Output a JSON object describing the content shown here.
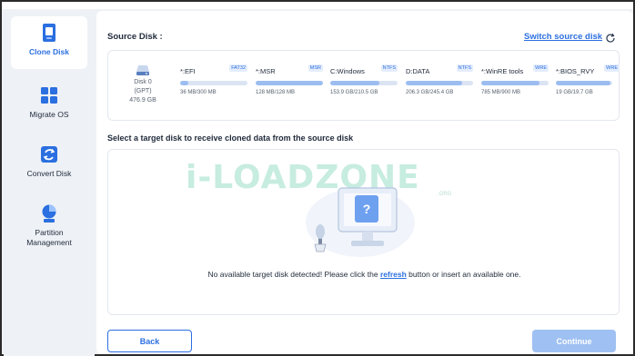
{
  "sidebar": {
    "items": [
      {
        "label": "Clone Disk",
        "icon": "clone-disk-icon",
        "active": true
      },
      {
        "label": "Migrate OS",
        "icon": "migrate-os-icon",
        "active": false
      },
      {
        "label": "Convert Disk",
        "icon": "convert-disk-icon",
        "active": false
      },
      {
        "label": "Partition\nManagement",
        "icon": "partition-management-icon",
        "active": false
      }
    ]
  },
  "source": {
    "title": "Source Disk :",
    "switch_label": "Switch source disk",
    "disk": {
      "name": "Disk 0",
      "style": "(GPT)",
      "size": "476.9 GB"
    },
    "partitions": [
      {
        "name": "*:EFI",
        "fs": "FAT32",
        "size": "36 MB/300 MB",
        "used_fraction": 0.12
      },
      {
        "name": "*:MSR",
        "fs": "MSR",
        "size": "128 MB/128 MB",
        "used_fraction": 1.0
      },
      {
        "name": "C:Windows",
        "fs": "NTFS",
        "size": "153.9 GB/210.5 GB",
        "used_fraction": 0.73
      },
      {
        "name": "D:DATA",
        "fs": "NTFS",
        "size": "206.3 GB/245.4 GB",
        "used_fraction": 0.84
      },
      {
        "name": "*:WinRE tools",
        "fs": "WRE",
        "size": "785 MB/900 MB",
        "used_fraction": 0.87
      },
      {
        "name": "*:BIOS_RVY",
        "fs": "WRE",
        "size": "19 GB/19.7 GB",
        "used_fraction": 0.96
      }
    ]
  },
  "target": {
    "title": "Select a target disk to receive cloned data from the source disk",
    "msg_before": "No available target disk detected! Please click the ",
    "msg_link": "refresh",
    "msg_after": " button or insert an available one.",
    "watermark": "i-LOADZONE",
    "watermark_org": ".ORG"
  },
  "buttons": {
    "back": "Back",
    "continue": "Continue"
  },
  "colors": {
    "accent": "#2b6fe0",
    "accent_disabled": "#9fc0f2",
    "sidebar_bg": "#eef1f6"
  }
}
